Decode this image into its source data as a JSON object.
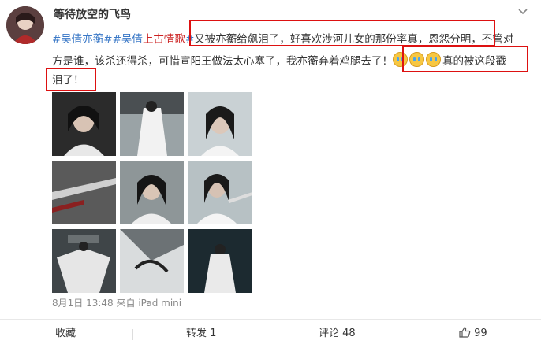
{
  "post": {
    "username": "等待放空的飞鸟",
    "tags": {
      "tag1": "#吴倩亦蘅#",
      "tag2_a": "#吴倩",
      "tag2_b": "上古情歌",
      "tag2_c": "#"
    },
    "line1_text": "又被亦蘅给飙泪了，好喜欢涉河儿女的那份率真，恩怨分明，不管对",
    "line2_text": "方是谁，该杀还得杀，可惜宣阳王做法太心塞了，我亦蘅弃着鸡腿去了！",
    "line2_tail": "真的被这段戳",
    "line3_text": "泪了！",
    "emojis": [
      "crying-emoji",
      "crying-emoji",
      "crying-emoji"
    ],
    "timestamp": "8月1日 13:48",
    "source_prefix": "来自",
    "source": "iPad mini"
  },
  "actions": {
    "favorite": "收藏",
    "repost": "转发 1",
    "comment": "评论 48",
    "like_count": "99"
  },
  "images": [
    {
      "caption": ""
    },
    {
      "caption": ""
    },
    {
      "caption": ""
    },
    {
      "caption": ""
    },
    {
      "caption": ""
    },
    {
      "caption": ""
    },
    {
      "caption": ""
    },
    {
      "caption": ""
    },
    {
      "caption": ""
    }
  ],
  "colors": {
    "tag": "#3b79c7",
    "tag_highlight": "#cc2222",
    "annotation_box": "#dd1111"
  }
}
